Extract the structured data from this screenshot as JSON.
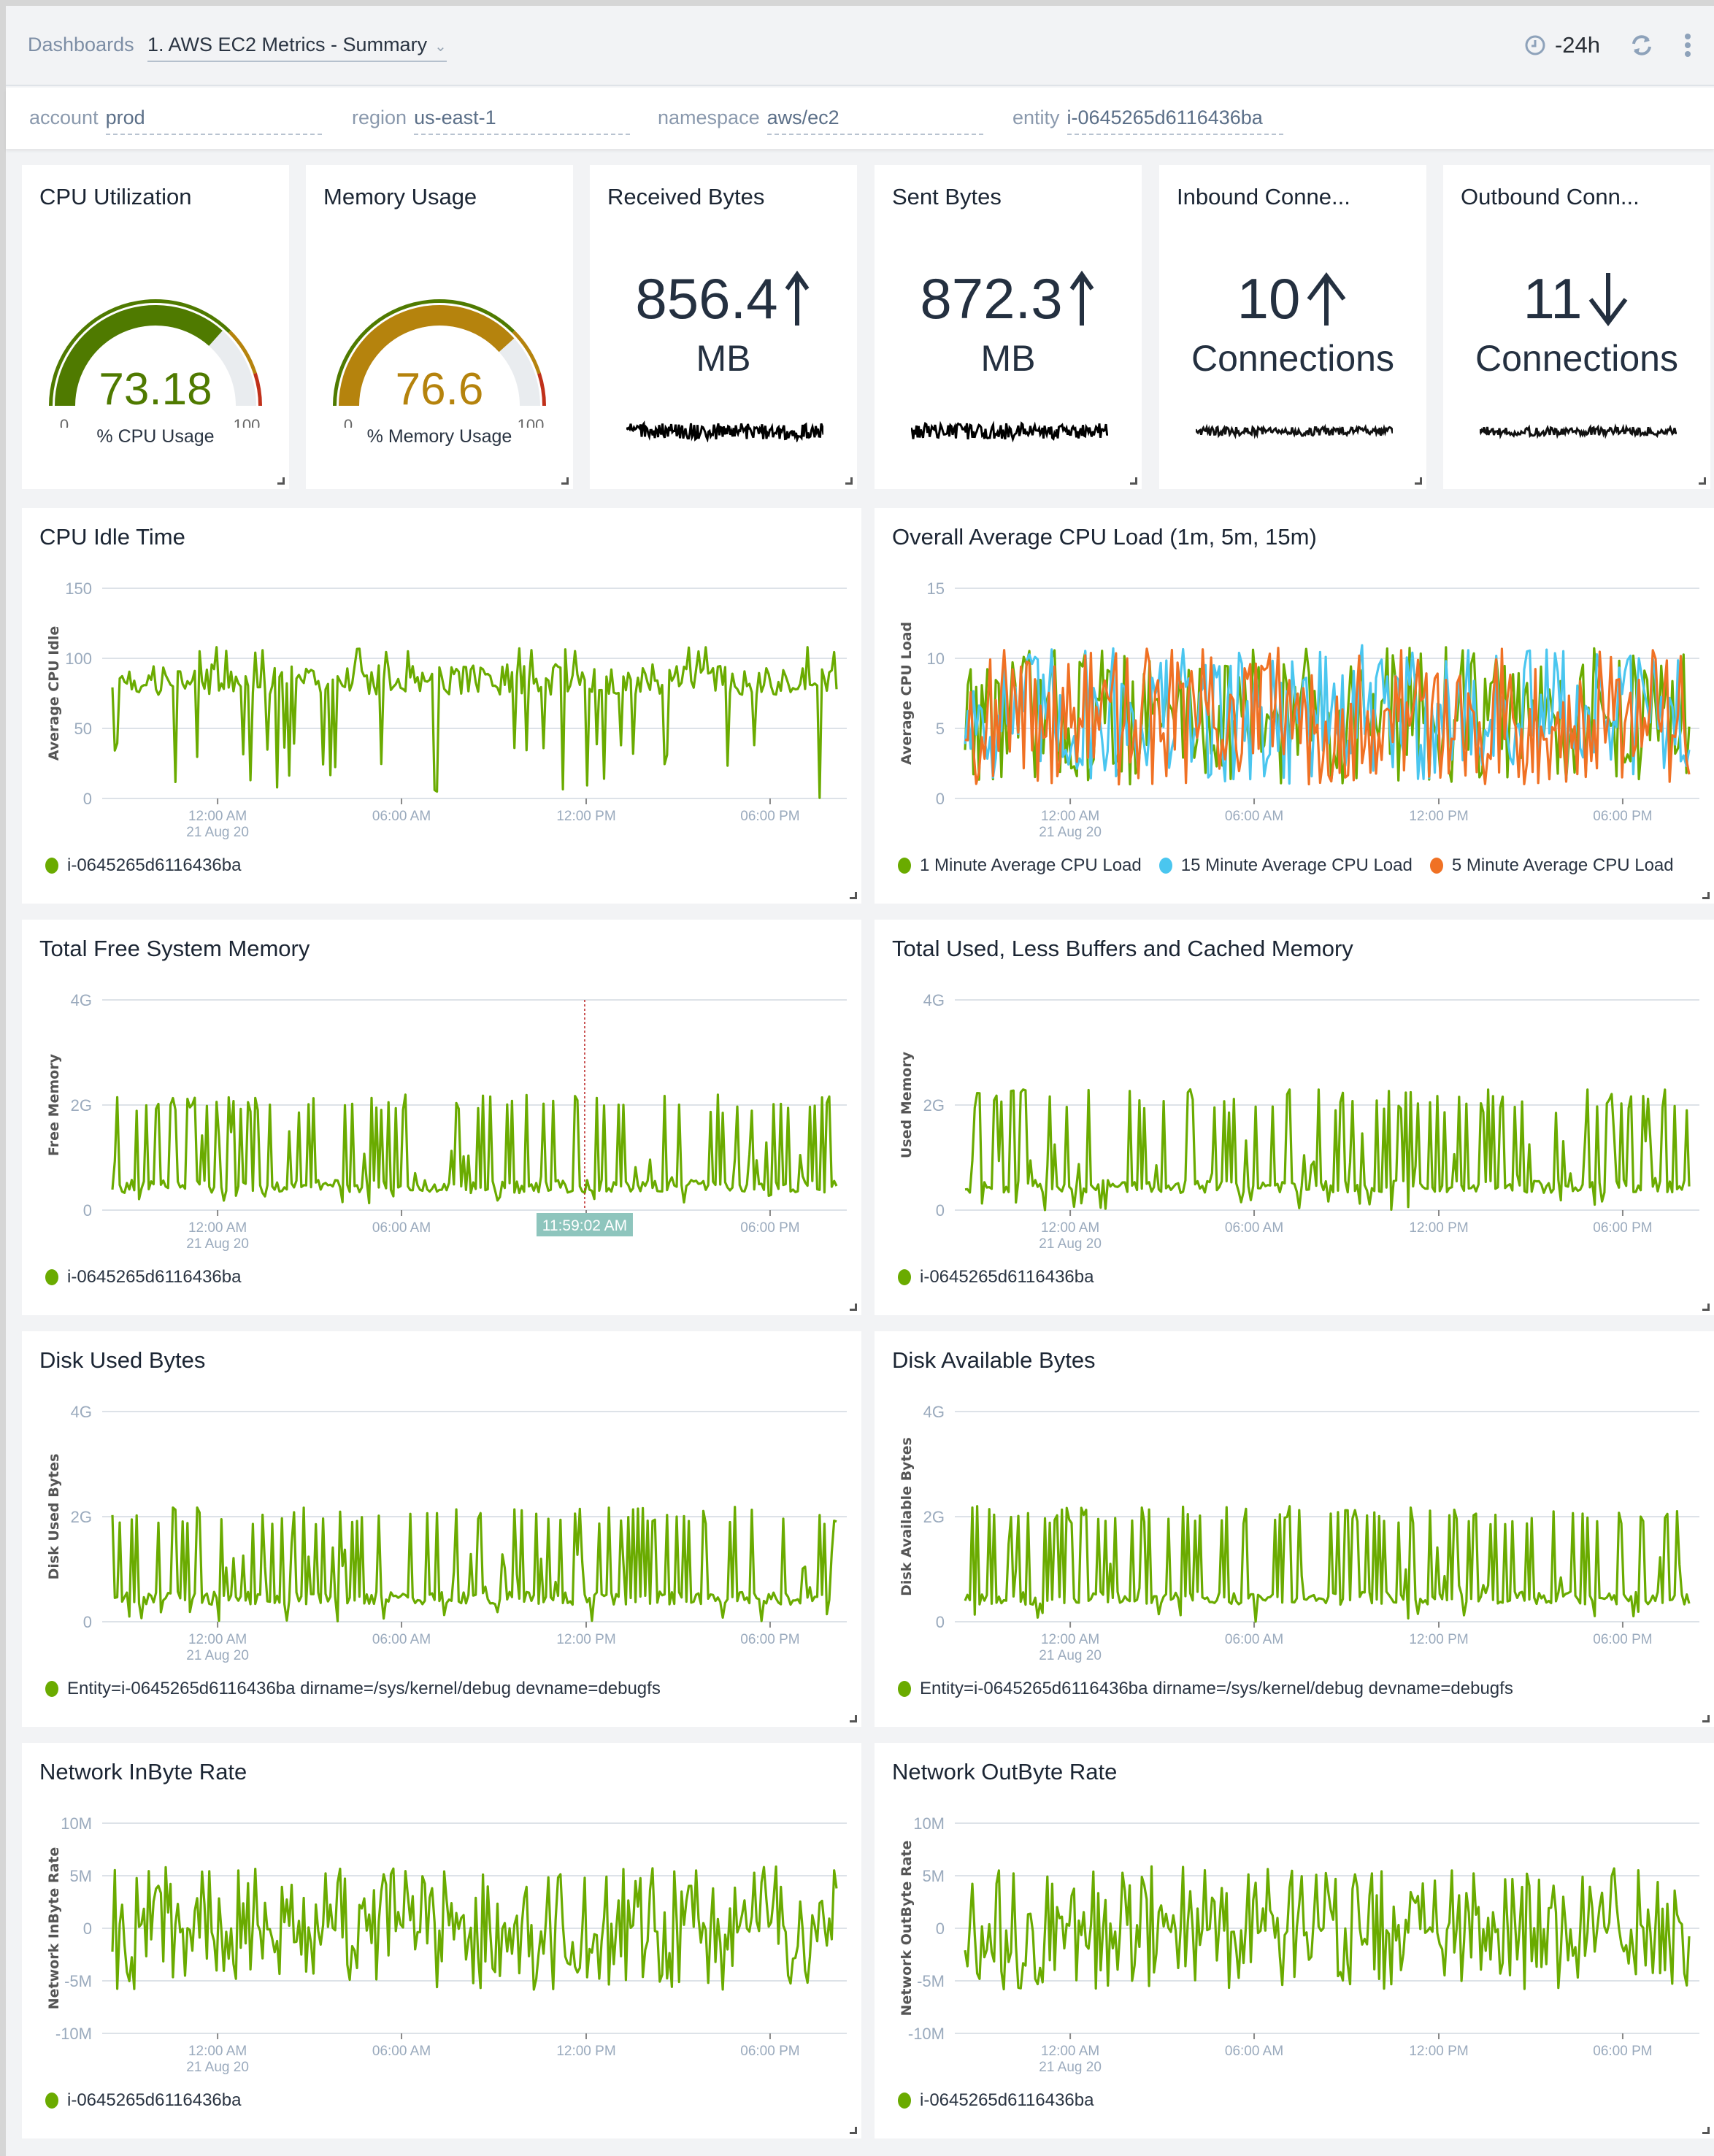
{
  "header": {
    "breadcrumb_root": "Dashboards",
    "dashboard_title": "1. AWS EC2 Metrics - Summary",
    "time_range": "-24h",
    "icons": {
      "clock": "clock-icon",
      "refresh": "refresh-icon",
      "more": "more-vertical-icon",
      "chevron": "chevron-down-icon"
    }
  },
  "filters": [
    {
      "label": "account",
      "value": "prod"
    },
    {
      "label": "region",
      "value": "us-east-1"
    },
    {
      "label": "namespace",
      "value": "aws/ec2"
    },
    {
      "label": "entity",
      "value": "i-0645265d6116436ba"
    }
  ],
  "tiles": [
    {
      "title": "CPU Utilization",
      "type": "gauge",
      "value": "73.18",
      "value_num": 73.18,
      "min": "0",
      "max": "100",
      "label": "% CPU Usage",
      "color": "#4f7a00",
      "thresholds": {
        "warn": 75,
        "crit": 90
      }
    },
    {
      "title": "Memory Usage",
      "type": "gauge",
      "value": "76.6",
      "value_num": 76.6,
      "min": "0",
      "max": "100",
      "label": "% Memory Usage",
      "color": "#b5830d",
      "thresholds": {
        "warn": 75,
        "crit": 90
      }
    },
    {
      "title": "Received Bytes",
      "type": "single",
      "value": "856.4",
      "unit": "MB",
      "trend": "up",
      "arrow": "↑"
    },
    {
      "title": "Sent Bytes",
      "type": "single",
      "value": "872.3",
      "unit": "MB",
      "trend": "up",
      "arrow": "↑"
    },
    {
      "title": "Inbound Conne...",
      "type": "single",
      "value": "10",
      "unit": "Connections",
      "trend": "up",
      "arrow": "🡑"
    },
    {
      "title": "Outbound Conn...",
      "type": "single",
      "value": "11",
      "unit": "Connections",
      "trend": "down",
      "arrow": "🡓"
    }
  ],
  "colors": {
    "green": "#6aab00",
    "cyan": "#4ac6ef",
    "orange": "#f07124",
    "gauge_green": "#4f7a00",
    "gauge_yellow": "#b5830d",
    "gauge_red": "#c0301a",
    "tooltip_bg": "#8ec5bd"
  },
  "x_ticks": [
    {
      "label": "12:00 AM",
      "sub": "21 Aug 20",
      "frac": 0.155
    },
    {
      "label": "06:00 AM",
      "sub": "",
      "frac": 0.402
    },
    {
      "label": "12:00 PM",
      "sub": "",
      "frac": 0.65
    },
    {
      "label": "06:00 PM",
      "sub": "",
      "frac": 0.897
    }
  ],
  "chart_data": [
    {
      "id": "cpu-idle",
      "type": "line",
      "title": "CPU Idle Time",
      "ylabel": "Average CPU Idle",
      "xlabel": "",
      "ylim": [
        0,
        150
      ],
      "yticks": [
        "0",
        "50",
        "100",
        "150"
      ],
      "ytick_values": [
        0,
        50,
        100,
        150
      ],
      "xrange": "-24h (approx 20 Aug 20 ~9:30 PM to 21 Aug 20 ~9:30 PM)",
      "series": [
        {
          "name": "i-0645265d6116436ba",
          "color": "#6aab00",
          "pattern": "idle",
          "min": 0,
          "max": 108,
          "baseline": 85
        }
      ],
      "grid": true,
      "legend": "bottom-left"
    },
    {
      "id": "cpu-load",
      "type": "line",
      "title": "Overall Average CPU Load (1m, 5m, 15m)",
      "ylabel": "Average CPU Load",
      "xlabel": "",
      "ylim": [
        0,
        15
      ],
      "yticks": [
        "0",
        "5",
        "10",
        "15"
      ],
      "ytick_values": [
        0,
        5,
        10,
        15
      ],
      "series": [
        {
          "name": "1 Minute Average CPU Load",
          "color": "#6aab00",
          "pattern": "load",
          "min": 0,
          "max": 10.8
        },
        {
          "name": "15 Minute Average CPU Load",
          "color": "#4ac6ef",
          "pattern": "load",
          "min": 0,
          "max": 11
        },
        {
          "name": "5 Minute Average CPU Load",
          "color": "#f07124",
          "pattern": "load",
          "min": 0,
          "max": 10.8
        }
      ],
      "grid": true,
      "legend": "bottom-left"
    },
    {
      "id": "free-mem",
      "type": "line",
      "title": "Total Free System Memory",
      "ylabel": "Free Memory",
      "xlabel": "",
      "ylim": [
        0,
        4
      ],
      "yticks": [
        "0",
        "2G",
        "4G"
      ],
      "ytick_values": [
        0,
        2,
        4
      ],
      "series": [
        {
          "name": "i-0645265d6116436ba",
          "color": "#6aab00",
          "pattern": "spiky",
          "min": 0.1,
          "max": 2.2,
          "baseline": 0.45
        }
      ],
      "crosshair": {
        "label": "11:59:02 AM",
        "frac": 0.648
      },
      "grid": true,
      "legend": "bottom-left"
    },
    {
      "id": "used-mem",
      "type": "line",
      "title": "Total Used, Less Buffers and Cached Memory",
      "ylabel": "Used Memory",
      "xlabel": "",
      "ylim": [
        0,
        4
      ],
      "yticks": [
        "0",
        "2G",
        "4G"
      ],
      "ytick_values": [
        0,
        2,
        4
      ],
      "series": [
        {
          "name": "i-0645265d6116436ba",
          "color": "#6aab00",
          "pattern": "spiky",
          "min": 0,
          "max": 2.3,
          "baseline": 0.45
        }
      ],
      "grid": true,
      "legend": "bottom-left"
    },
    {
      "id": "disk-used",
      "type": "line",
      "title": "Disk Used Bytes",
      "ylabel": "Disk Used Bytes",
      "xlabel": "",
      "ylim": [
        0,
        4
      ],
      "yticks": [
        "0",
        "2G",
        "4G"
      ],
      "ytick_values": [
        0,
        2,
        4
      ],
      "series": [
        {
          "name": "Entity=i-0645265d6116436ba dirname=/sys/kernel/debug devname=debugfs",
          "color": "#6aab00",
          "pattern": "spiky",
          "min": 0,
          "max": 2.2,
          "baseline": 0.45
        }
      ],
      "grid": true,
      "legend": "bottom-left"
    },
    {
      "id": "disk-avail",
      "type": "line",
      "title": "Disk Available Bytes",
      "ylabel": "Disk Available Bytes",
      "xlabel": "",
      "ylim": [
        0,
        4
      ],
      "yticks": [
        "0",
        "2G",
        "4G"
      ],
      "ytick_values": [
        0,
        2,
        4
      ],
      "series": [
        {
          "name": "Entity=i-0645265d6116436ba dirname=/sys/kernel/debug devname=debugfs",
          "color": "#6aab00",
          "pattern": "spiky",
          "min": 0,
          "max": 2.2,
          "baseline": 0.45
        }
      ],
      "grid": true,
      "legend": "bottom-left"
    },
    {
      "id": "net-in",
      "type": "line",
      "title": "Network InByte Rate",
      "ylabel": "Network InByte Rate",
      "xlabel": "",
      "ylim": [
        -10,
        10
      ],
      "yticks": [
        "-10M",
        "-5M",
        "0",
        "5M",
        "10M"
      ],
      "ytick_values": [
        -10,
        -5,
        0,
        5,
        10
      ],
      "series": [
        {
          "name": "i-0645265d6116436ba",
          "color": "#6aab00",
          "pattern": "noise",
          "min": -5.9,
          "max": 5.9
        }
      ],
      "grid": true,
      "legend": "bottom-left"
    },
    {
      "id": "net-out",
      "type": "line",
      "title": "Network OutByte Rate",
      "ylabel": "Network OutByte Rate",
      "xlabel": "",
      "ylim": [
        -10,
        10
      ],
      "yticks": [
        "-10M",
        "-5M",
        "0",
        "5M",
        "10M"
      ],
      "ytick_values": [
        -10,
        -5,
        0,
        5,
        10
      ],
      "series": [
        {
          "name": "i-0645265d6116436ba",
          "color": "#6aab00",
          "pattern": "noise",
          "min": -5.8,
          "max": 5.9
        }
      ],
      "grid": true,
      "legend": "bottom-left"
    }
  ]
}
